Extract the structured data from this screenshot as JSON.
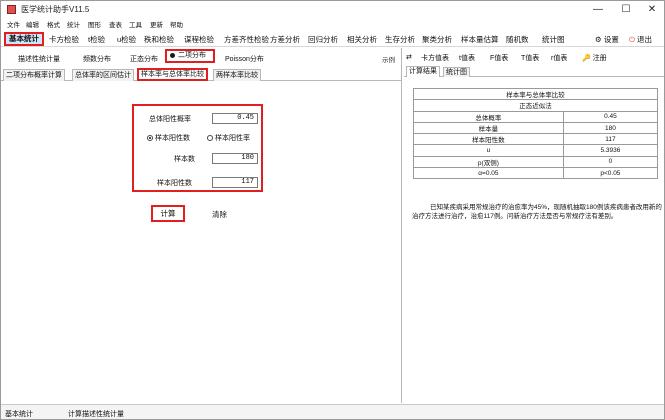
{
  "window": {
    "title": "医学统计助手V11.5",
    "controls": [
      "—",
      "☐",
      "✕"
    ]
  },
  "menubar": [
    "文件",
    "编辑",
    "格式",
    "统计",
    "图形",
    "查表",
    "工具",
    "更新",
    "帮助"
  ],
  "toolbar": {
    "items": [
      "基本统计",
      "卡方检验",
      "t检验",
      "u检验",
      "秩和检验",
      "谋程检验",
      "方差齐性检验",
      "方差分析",
      "回归分析",
      "相关分析",
      "生存分析",
      "聚类分析",
      "样本量估算",
      "随机数",
      "统计图"
    ],
    "active_index": 0,
    "settings": "设置",
    "exit": "退出"
  },
  "subtoolbar": {
    "items": [
      "描述性统计量",
      "频数分布",
      "正态分布",
      "二项分布",
      "Poisson分布"
    ],
    "active_index": 3,
    "example": "示例"
  },
  "left_tabs": {
    "items": [
      "二项分布概率计算",
      "总体率的区间估计",
      "样本率与总体率比较",
      "两样本率比较"
    ],
    "active_index": 2
  },
  "form": {
    "population_positive_rate_label": "总体阳性概率",
    "population_positive_rate_value": "0.45",
    "radio_sample_positive": "样本阳性数",
    "radio_sample_rate": "样本阳性率",
    "radio_selected": "样本阳性数",
    "sample_size_label": "样本数",
    "sample_size_value": "180",
    "sample_positive_label": "样本阳性数",
    "sample_positive_value": "117"
  },
  "actions": {
    "calc": "计算",
    "clear": "清除"
  },
  "right_toolbar": [
    "⇄",
    "卡方值表",
    "t值表",
    "F值表",
    "T值表",
    "r值表",
    "注册"
  ],
  "right_tabs": {
    "items": [
      "计算结果",
      "统计图"
    ],
    "active_index": 0
  },
  "results": {
    "title": "样本率与总体率比较",
    "method": "正态近似法",
    "rows": [
      [
        "总体概率",
        "0.45"
      ],
      [
        "样本量",
        "180"
      ],
      [
        "样本阳性数",
        "117"
      ],
      [
        "u",
        "5.3936"
      ],
      [
        "p(双侧)",
        "0"
      ],
      [
        "α=0.05",
        "p<0.05"
      ]
    ],
    "note": "已知某疾病采用常规治疗的治愈率为45%，现随机抽取180例该疾病患者改用新的治疗方法进行治疗，治愈117例。问新治疗方法是否与常规疗法有差别。"
  },
  "statusbar": {
    "left": "基本统计",
    "right": "计算描述性统计量"
  },
  "colors": {
    "highlight_border": "#e02020",
    "active_tab_bg": "#cfe6fa"
  }
}
